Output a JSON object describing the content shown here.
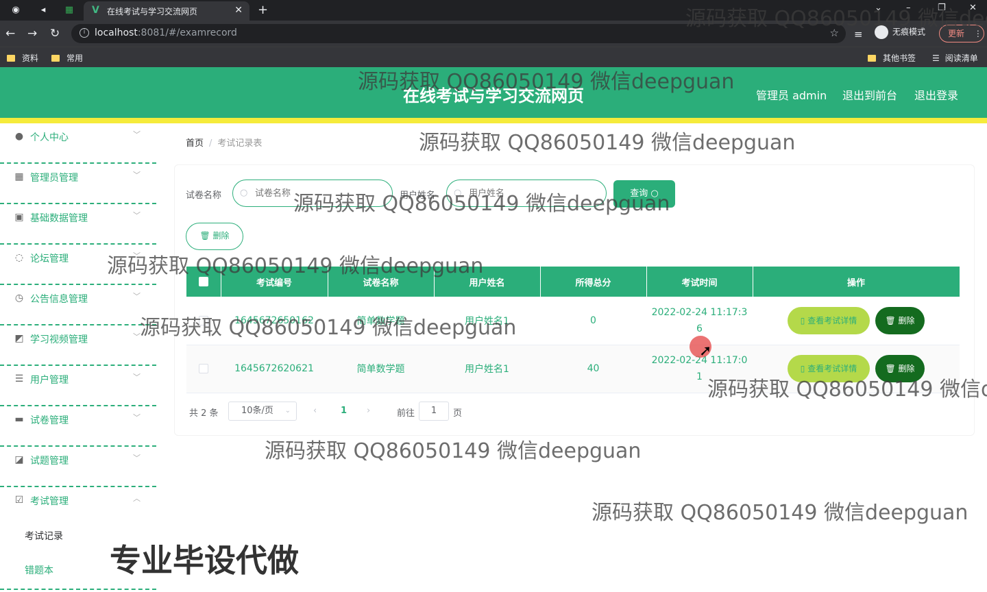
{
  "browser": {
    "tab_title": "在线考试与学习交流网页",
    "url_host": "localhost",
    "url_rest": ":8081/#/examrecord",
    "incognito_label": "无痕模式",
    "update_label": "更新",
    "bookmarks": [
      "资料",
      "常用"
    ],
    "bookmarks_right": [
      "其他书签",
      "阅读清单"
    ]
  },
  "header": {
    "title": "在线考试与学习交流网页",
    "admin_label": "管理员 admin",
    "back_label": "退出到前台",
    "logout_label": "退出登录"
  },
  "sidebar": {
    "items": [
      {
        "label": "个人中心",
        "icon": "user-icon"
      },
      {
        "label": "管理员管理",
        "icon": "grid-icon"
      },
      {
        "label": "基础数据管理",
        "icon": "clipboard-icon"
      },
      {
        "label": "论坛管理",
        "icon": "power-icon"
      },
      {
        "label": "公告信息管理",
        "icon": "clock-icon"
      },
      {
        "label": "学习视频管理",
        "icon": "chart-icon"
      },
      {
        "label": "用户管理",
        "icon": "list-icon"
      },
      {
        "label": "试卷管理",
        "icon": "message-icon"
      },
      {
        "label": "试题管理",
        "icon": "truck-icon"
      },
      {
        "label": "考试管理",
        "icon": "check-icon"
      }
    ],
    "sub_items": [
      "考试记录",
      "错题本"
    ]
  },
  "breadcrumb": {
    "home": "首页",
    "separator": "/",
    "current": "考试记录表"
  },
  "filters": {
    "paper_label": "试卷名称",
    "paper_placeholder": "试卷名称",
    "user_label": "用户姓名",
    "user_placeholder": "用户姓名",
    "query_label": "查询"
  },
  "toolbar": {
    "delete_label": "删除"
  },
  "table": {
    "columns": [
      "考试编号",
      "试卷名称",
      "用户姓名",
      "所得总分",
      "考试时间",
      "操作"
    ],
    "rows": [
      {
        "id": "1645672650162",
        "paper": "简单数学题",
        "user": "用户姓名1",
        "score": "0",
        "time": "2022-02-24 11:17:36"
      },
      {
        "id": "1645672620621",
        "paper": "简单数学题",
        "user": "用户姓名1",
        "score": "40",
        "time": "2022-02-24 11:17:01"
      }
    ],
    "detail_label": "查看考试详情",
    "delete_label": "删除"
  },
  "pager": {
    "total": "共 2 条",
    "page_size": "10条/页",
    "current_page": "1",
    "goto_label": "前往",
    "goto_value": "1",
    "page_suffix": "页"
  },
  "watermark": "源码获取 QQ86050149 微信deepguan",
  "promo": "专业毕设代做",
  "colors": {
    "primary": "#2bae7a",
    "accent_bar": "#f5eb3b",
    "detail_btn": "#b4d94a",
    "danger_btn": "#146b1f"
  }
}
